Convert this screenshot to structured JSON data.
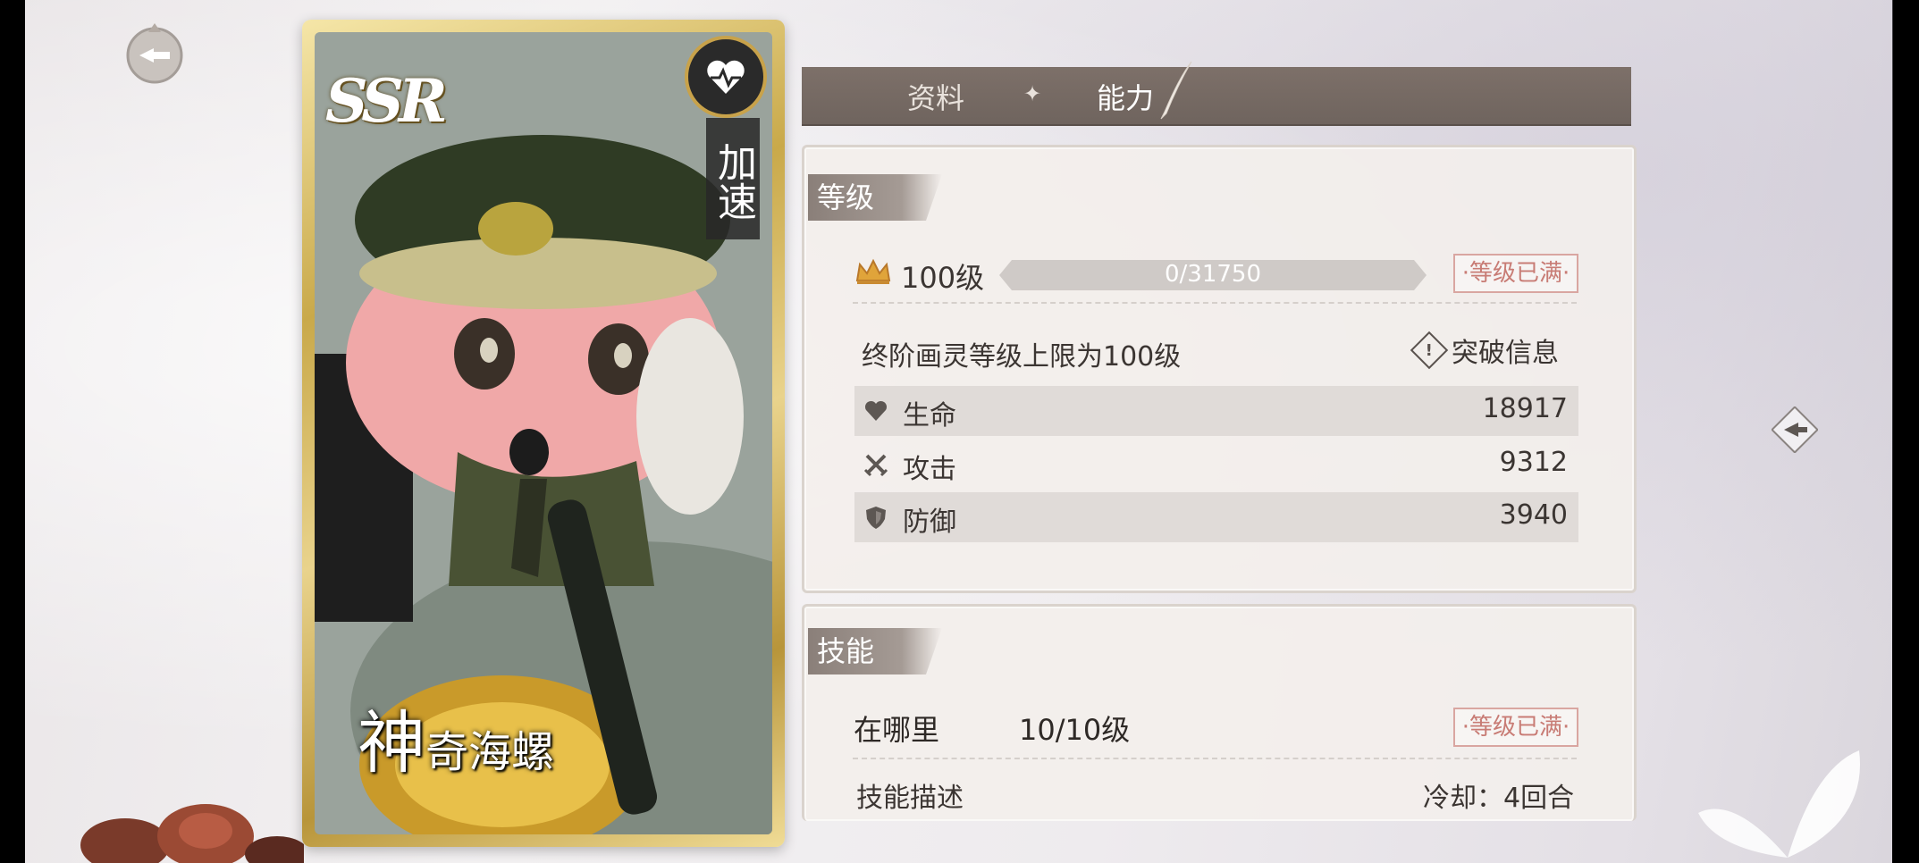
{
  "card": {
    "rarity": "SSR",
    "tag": "加速",
    "name_big": "神",
    "name_rest": "奇海螺"
  },
  "tabs": {
    "info": "资料",
    "ability": "能力",
    "active": "ability"
  },
  "level_section": {
    "title": "等级",
    "level_text": "100级",
    "xp_text": "0/31750",
    "xp_progress": 0,
    "max_badge": "·等级已满·",
    "note": "终阶画灵等级上限为100级",
    "breach_label": "突破信息",
    "stats": [
      {
        "icon": "heart-icon",
        "name": "生命",
        "value": "18917"
      },
      {
        "icon": "crossed-swords-icon",
        "name": "攻击",
        "value": "9312"
      },
      {
        "icon": "shield-icon",
        "name": "防御",
        "value": "3940"
      }
    ]
  },
  "skill_section": {
    "title": "技能",
    "skill_name": "在哪里",
    "skill_level": "10/10级",
    "max_badge": "·等级已满·",
    "desc_label": "技能描述",
    "cooldown": "冷却：4回合"
  },
  "colors": {
    "tabbar": "#756962",
    "max_badge": "#c87c75",
    "card_gold": "#c9a94a"
  }
}
